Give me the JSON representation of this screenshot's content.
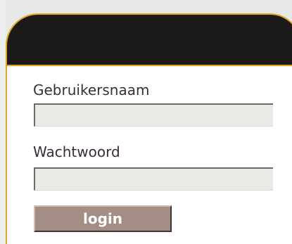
{
  "login_form": {
    "username_label": "Gebruikersnaam",
    "username_value": "",
    "password_label": "Wachtwoord",
    "password_value": "",
    "login_button_label": "login"
  },
  "colors": {
    "header_background": "#1b1a18",
    "accent_border": "#e0a520",
    "page_background": "#e6e9e6",
    "input_background": "#e8ebe6",
    "button_background": "#a48d84",
    "button_text": "#ffffff",
    "label_text": "#3a2e3a"
  }
}
